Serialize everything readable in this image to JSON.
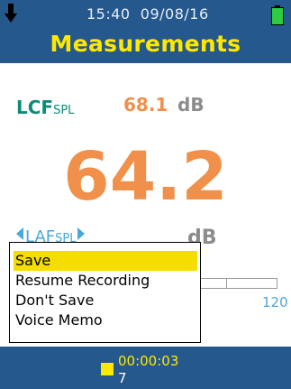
{
  "header": {
    "time": "15:40",
    "date": "09/08/16",
    "title": "Measurements",
    "icons": {
      "left": "download-arrow-icon",
      "right": "battery-full-icon"
    },
    "colors": {
      "bar": "#25588c",
      "title": "#ffe800",
      "battery": "#2ecc40"
    }
  },
  "measurement": {
    "secondary_param_main": "LCF",
    "secondary_param_sub": "SPL",
    "secondary_value": "68.1",
    "secondary_unit": "dB",
    "primary_value": "64.2",
    "primary_param_main": "LAF",
    "primary_param_sub": "SPL",
    "primary_unit": "dB",
    "scale_max": "120",
    "colors": {
      "param": "#0e8b78",
      "value": "#f0904a",
      "unit": "#8c8c8c",
      "selector": "#4aa8d8"
    }
  },
  "menu": {
    "items": [
      {
        "label": "Save",
        "selected": true
      },
      {
        "label": "Resume Recording",
        "selected": false
      },
      {
        "label": "Don't Save",
        "selected": false
      },
      {
        "label": "Voice Memo",
        "selected": false
      }
    ],
    "highlight_color": "#f5dd00"
  },
  "footer": {
    "elapsed": "00:00:03",
    "record_count": "7",
    "icon": "recording-square-icon"
  }
}
